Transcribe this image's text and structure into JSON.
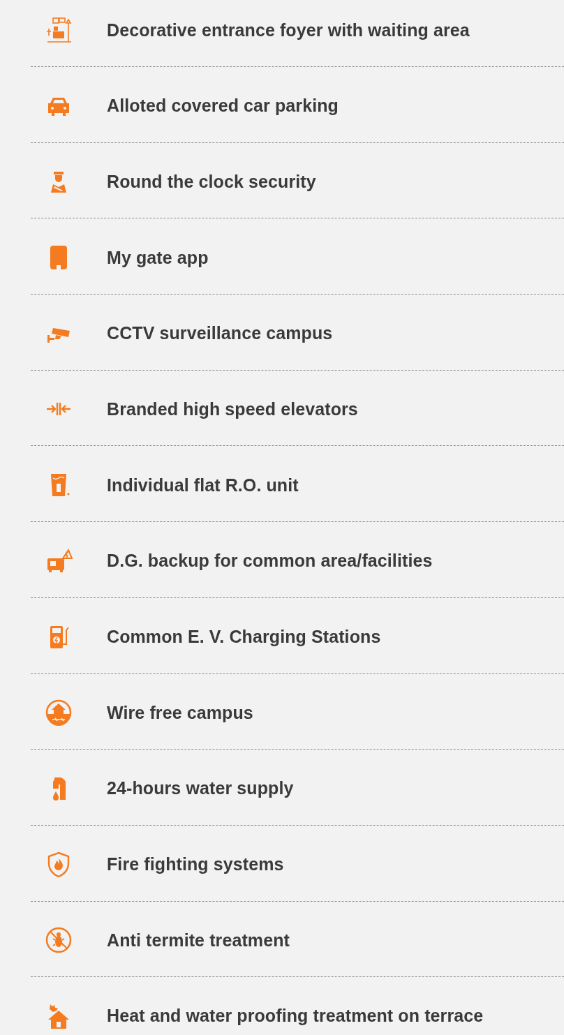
{
  "amenities": [
    {
      "label": "Decorative entrance foyer with waiting area"
    },
    {
      "label": "Alloted covered car parking"
    },
    {
      "label": "Round the clock security"
    },
    {
      "label": "My gate app"
    },
    {
      "label": "CCTV surveillance campus"
    },
    {
      "label": "Branded high speed elevators"
    },
    {
      "label": "Individual flat R.O. unit"
    },
    {
      "label": "D.G. backup for common area/facilities"
    },
    {
      "label": "Common E. V. Charging Stations"
    },
    {
      "label": "Wire free campus"
    },
    {
      "label": "24-hours water supply"
    },
    {
      "label": "Fire fighting systems"
    },
    {
      "label": "Anti termite treatment"
    },
    {
      "label": "Heat and water proofing treatment on terrace"
    }
  ]
}
